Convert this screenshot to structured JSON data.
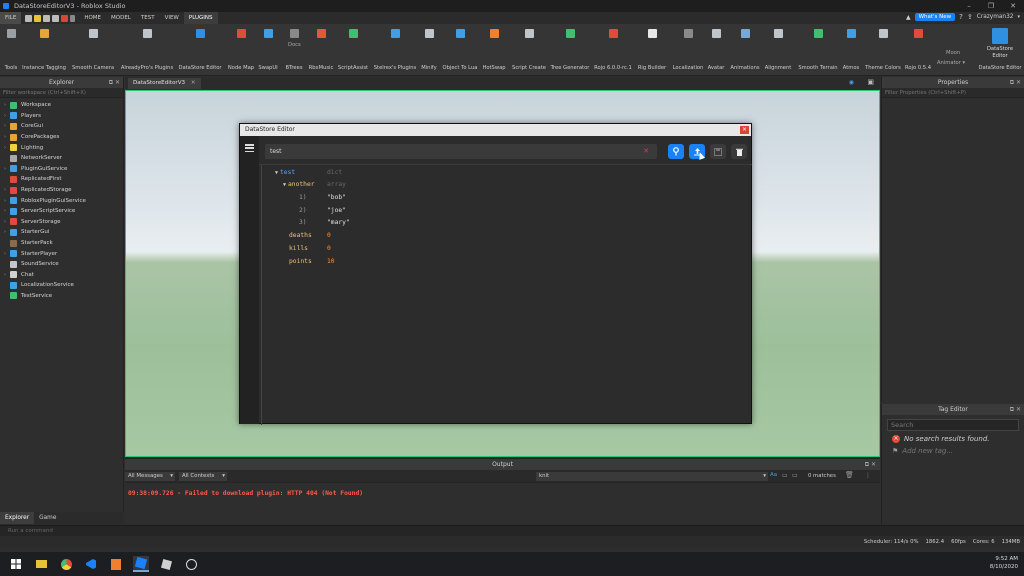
{
  "window": {
    "title": "DataStoreEditorV3 - Roblox Studio"
  },
  "menu": {
    "file": "FILE",
    "tabs": [
      {
        "label": "HOME"
      },
      {
        "label": "MODEL"
      },
      {
        "label": "TEST"
      },
      {
        "label": "VIEW"
      },
      {
        "label": "PLUGINS"
      }
    ],
    "whats_new": "What's New",
    "user": "Crazyman32"
  },
  "ribbon": {
    "buttons": [
      {
        "label": "Tools",
        "color": "#9aa0a6"
      },
      {
        "label": "Instance Tagging",
        "color": "#e8a33a"
      },
      {
        "label": "Smooth Camera",
        "color": "#bfc5cc"
      },
      {
        "label": "AlreadyPro's Plugins",
        "color": "#bfc5cc"
      },
      {
        "label": "DataStore Editor",
        "color": "#2f8fe0"
      },
      {
        "label": "Node Map",
        "color": "#e14b3b"
      },
      {
        "label": "SwapUI",
        "color": "#3fa0e8"
      },
      {
        "label": "BTrees",
        "color": "#8a8a8a"
      },
      {
        "label": "RbxMusic",
        "color": "#e05a3a"
      },
      {
        "label": "ScriptAssist",
        "color": "#3fbf6f"
      },
      {
        "label": "Stelrex's Plugins",
        "color": "#3fa0e8"
      },
      {
        "label": "Minify",
        "color": "#bfc5cc"
      },
      {
        "label": "Object To Lua",
        "color": "#3fa0e8"
      },
      {
        "label": "HotSwap",
        "color": "#f08030"
      },
      {
        "label": "Script Create",
        "color": "#bfc5cc"
      },
      {
        "label": "Tree Generator",
        "color": "#3fbf6f"
      },
      {
        "label": "Rojo 6.0.0-rc.1",
        "color": "#e14b3b"
      },
      {
        "label": "Rig Builder",
        "color": "#e8e8e8"
      },
      {
        "label": "Localization",
        "color": "#8a8a8a"
      },
      {
        "label": "Avatar",
        "color": "#bfc5cc"
      },
      {
        "label": "Animations",
        "color": "#7aa7d6"
      },
      {
        "label": "Alignment",
        "color": "#bfc5cc"
      },
      {
        "label": "Smooth Terrain",
        "color": "#3fbf6f"
      },
      {
        "label": "Atmos",
        "color": "#3fa0e8"
      },
      {
        "label": "Theme Colors",
        "color": "#bfc5cc"
      },
      {
        "label": "Rojo 0.5.4",
        "color": "#e14b3b"
      },
      {
        "label": "DataStore Editor",
        "color": "#2f8fe0"
      }
    ],
    "extra": {
      "doc": "Docs",
      "moon": "Moon",
      "animator": "Animator ▾",
      "dse_big": "DataStore Editor"
    }
  },
  "explorer": {
    "title": "Explorer",
    "filter_placeholder": "Filter workspace (Ctrl+Shift+X)",
    "items": [
      {
        "label": "Workspace",
        "color": "#3fbf6f",
        "expandable": true
      },
      {
        "label": "Players",
        "color": "#3fa0e8",
        "expandable": true
      },
      {
        "label": "CoreGui",
        "color": "#e8a33a",
        "expandable": true
      },
      {
        "label": "CorePackages",
        "color": "#e8a33a",
        "expandable": true
      },
      {
        "label": "Lighting",
        "color": "#f2d23a",
        "expandable": true
      },
      {
        "label": "NetworkServer",
        "color": "#aaaaaa",
        "expandable": false
      },
      {
        "label": "PluginGuiService",
        "color": "#3fa0e8",
        "expandable": true
      },
      {
        "label": "ReplicatedFirst",
        "color": "#e14b3b",
        "expandable": false
      },
      {
        "label": "ReplicatedStorage",
        "color": "#e14b3b",
        "expandable": true
      },
      {
        "label": "RobloxPluginGuiService",
        "color": "#3fa0e8",
        "expandable": true
      },
      {
        "label": "ServerScriptService",
        "color": "#3fa0e8",
        "expandable": true
      },
      {
        "label": "ServerStorage",
        "color": "#e14b3b",
        "expandable": true
      },
      {
        "label": "StarterGui",
        "color": "#3fa0e8",
        "expandable": true
      },
      {
        "label": "StarterPack",
        "color": "#8a6a4a",
        "expandable": false
      },
      {
        "label": "StarterPlayer",
        "color": "#3fa0e8",
        "expandable": true
      },
      {
        "label": "SoundService",
        "color": "#bfc5cc",
        "expandable": false
      },
      {
        "label": "Chat",
        "color": "#d0d0d0",
        "expandable": true
      },
      {
        "label": "LocalizationService",
        "color": "#3fa0e8",
        "expandable": false
      },
      {
        "label": "TestService",
        "color": "#3fbf6f",
        "expandable": false
      }
    ],
    "tabs": [
      "Explorer",
      "Game"
    ]
  },
  "viewport": {
    "tab_label": "DataStoreEditorV3"
  },
  "dse": {
    "title": "DataStore Editor",
    "search_value": "test",
    "rows": [
      {
        "key": "test",
        "type": "dict"
      },
      {
        "key": "another",
        "type": "array"
      },
      {
        "index": "1)",
        "value": "\"bob\""
      },
      {
        "index": "2)",
        "value": "\"joe\""
      },
      {
        "index": "3)",
        "value": "\"mary\""
      },
      {
        "key": "deaths",
        "value": "0"
      },
      {
        "key": "kills",
        "value": "0"
      },
      {
        "key": "points",
        "value": "10"
      }
    ]
  },
  "output": {
    "title": "Output",
    "messages_filter": "All Messages",
    "contexts_filter": "All Contexts",
    "search_value": "knit",
    "case_label": "Aa",
    "matches": "0 matches",
    "error": "09:38:09.726 - Failed to download plugin: HTTP 404 (Not Found)"
  },
  "properties": {
    "title": "Properties",
    "filter_placeholder": "Filter Properties (Ctrl+Shift+P)"
  },
  "tag_editor": {
    "title": "Tag Editor",
    "search_placeholder": "Search",
    "no_results": "No search results found.",
    "add_new": "Add new tag..."
  },
  "command_bar": {
    "placeholder": "Run a command"
  },
  "status": {
    "scheduler": "Scheduler: 114/s 0%",
    "mem": "1862.4",
    "fps": "60fps",
    "cores": "Cores: 6",
    "ram": "134MB"
  },
  "taskbar": {
    "time": "9:52 AM",
    "date": "8/10/2020"
  }
}
